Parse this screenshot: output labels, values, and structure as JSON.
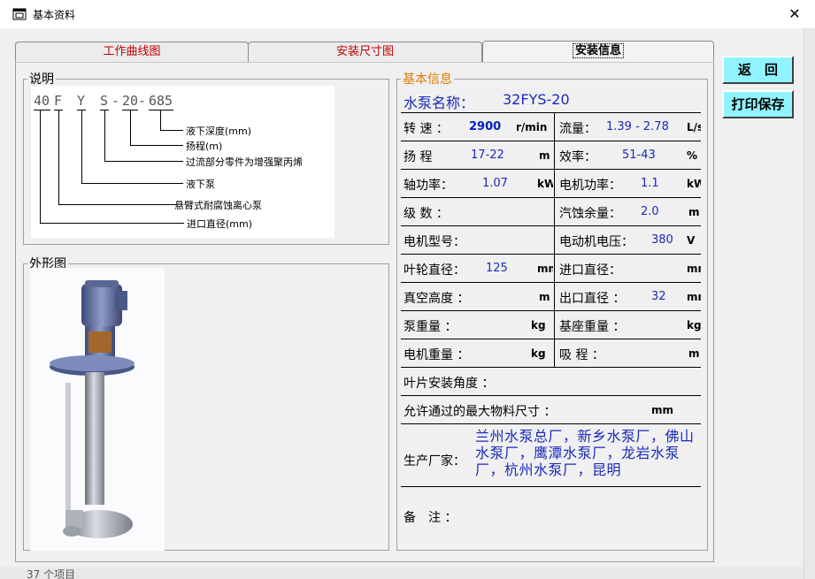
{
  "window": {
    "title": "基本资料",
    "close": "✕"
  },
  "tabs": [
    "工作曲线图",
    "安装尺寸图",
    "安装信息"
  ],
  "buttons": {
    "return": "返　回",
    "print_save": "打印保存"
  },
  "explain": {
    "legend": "说明",
    "code": [
      "40",
      "F",
      "Y",
      "S",
      "-",
      "20",
      "-",
      "685"
    ],
    "labels": [
      "液下深度(mm)",
      "扬程(m)",
      "过流部分零件为增强聚丙烯",
      "液下泵",
      "悬臂式耐腐蚀离心泵",
      "进口直径(mm)"
    ]
  },
  "shape": {
    "legend": "外形图"
  },
  "basic": {
    "legend": "基本信息",
    "pump_name_label": "水泵名称：",
    "pump_name": "32FYS-20",
    "speed_label": "转 速 ：",
    "speed": "2900",
    "speed_unit": "r/min",
    "flow_label": "流量：",
    "flow": "1.39 - 2.78",
    "flow_unit": "L/s",
    "head_label": "扬 程",
    "head": "17-22",
    "head_unit": "m",
    "eff_label": "效率：",
    "eff": "51-43",
    "eff_unit": "%",
    "shaft_power_label": "轴功率：",
    "shaft_power": "1.07",
    "shaft_power_unit": "kW",
    "motor_power_label": "电机功率：",
    "motor_power": "1.1",
    "motor_power_unit": "kW",
    "stages_label": "级 数 ：",
    "npsh_label": "汽蚀余量：",
    "npsh": "2.0",
    "npsh_unit": "m",
    "motor_model_label": "电机型号：",
    "motor_voltage_label": "电动机电压：",
    "motor_voltage": "380",
    "motor_voltage_unit": "V",
    "impeller_label": "叶轮直径：",
    "impeller": "125",
    "impeller_unit": "mm",
    "inlet_label": "进口直径：",
    "inlet_unit": "mm",
    "vacuum_label": "真空高度 ：",
    "vacuum_unit": "m",
    "outlet_label": "出口直径 ：",
    "outlet": "32",
    "outlet_unit": "mm",
    "pump_weight_label": "泵重量 ：",
    "pump_weight_unit": "kg",
    "base_weight_label": "基座重量 ：",
    "base_weight_unit": "kg",
    "motor_weight_label": "电机重量 ：",
    "motor_weight_unit": "kg",
    "suction_label": "吸 程 ：",
    "suction_unit": "m",
    "blade_angle_label": "叶片安装角度 ：",
    "max_material_label": "允许通过的最大物料尺寸 ：",
    "max_material_unit": "mm",
    "manufacturer_label": "生产厂家：",
    "manufacturer": "兰州水泵总厂，新乡水泵厂，佛山水泵厂，鹰潭水泵厂，龙岩水泵厂，杭州水泵厂，昆明",
    "remarks_label": "备　注 ："
  },
  "background": {
    "bottom_text": "37 个项目"
  }
}
